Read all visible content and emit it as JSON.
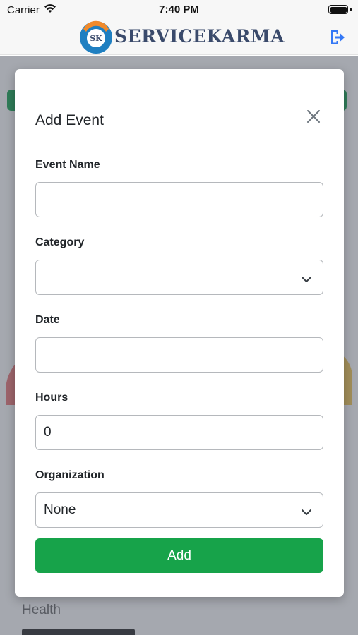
{
  "status_bar": {
    "carrier": "Carrier",
    "time": "7:40 PM"
  },
  "header": {
    "brand": "SERVICEKARMA",
    "logo_text": "SK"
  },
  "background": {
    "health_label": "Health"
  },
  "modal": {
    "title": "Add Event",
    "fields": {
      "event_name": {
        "label": "Event Name",
        "value": ""
      },
      "category": {
        "label": "Category",
        "value": ""
      },
      "date": {
        "label": "Date",
        "value": ""
      },
      "hours": {
        "label": "Hours",
        "value": "0"
      },
      "organization": {
        "label": "Organization",
        "value": "None"
      }
    },
    "add_label": "Add"
  },
  "colors": {
    "primary_green": "#17a34a",
    "logout_blue": "#3478f6",
    "brand_text": "#3a4a6b"
  },
  "icons": [
    "wifi-icon",
    "battery-icon",
    "logo-icon",
    "logout-icon",
    "close-icon",
    "chevron-down-icon"
  ]
}
